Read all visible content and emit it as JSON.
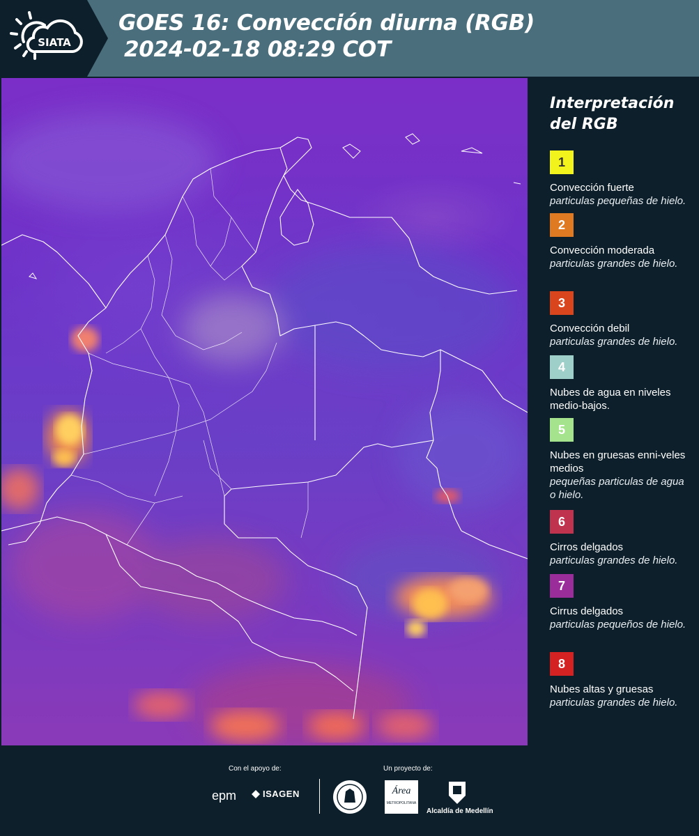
{
  "header": {
    "logo_text": "SIATA",
    "title_line1": "GOES 16: Convección diurna (RGB)",
    "title_line2": "2024-02-18 08:29 COT"
  },
  "legend": {
    "title_line1": "Interpretación",
    "title_line2": "del RGB",
    "items": [
      {
        "num": "1",
        "color": "#f2f21c",
        "text_color": "#333333",
        "name": "Convección fuerte",
        "desc": "particulas pequeñas de hielo."
      },
      {
        "num": "2",
        "color": "#e07a22",
        "text_color": "#ffffff",
        "name": "Convección moderada",
        "desc": "particulas grandes de hielo."
      },
      {
        "num": "3",
        "color": "#d9461e",
        "text_color": "#ffffff",
        "name": "Convección debil",
        "desc": "particulas grandes de hielo."
      },
      {
        "num": "4",
        "color": "#9ecfc8",
        "text_color": "#ffffff",
        "name": "Nubes de agua en niveles medio-bajos.",
        "desc": ""
      },
      {
        "num": "5",
        "color": "#a6e38d",
        "text_color": "#ffffff",
        "name": "Nubes en gruesas enni-veles medios",
        "desc": "pequeñas particulas de agua o hielo."
      },
      {
        "num": "6",
        "color": "#c0334f",
        "text_color": "#ffffff",
        "name": "Cirros delgados",
        "desc": "particulas grandes de hielo."
      },
      {
        "num": "7",
        "color": "#9b2d9b",
        "text_color": "#ffffff",
        "name": "Cirrus delgados",
        "desc": "particulas pequeños de hielo."
      },
      {
        "num": "8",
        "color": "#d42222",
        "text_color": "#ffffff",
        "name": "Nubes altas y gruesas",
        "desc": "particulas grandes de hielo."
      }
    ]
  },
  "footer": {
    "support_label": "Con el apoyo de:",
    "project_label": "Un proyecto de:",
    "sponsor1": "epm",
    "sponsor2": "ISAGEN",
    "partner_area": "Área",
    "partner_area_sub": "METROPOLITANA",
    "partner_medellin": "Alcaldía de Medellín"
  }
}
